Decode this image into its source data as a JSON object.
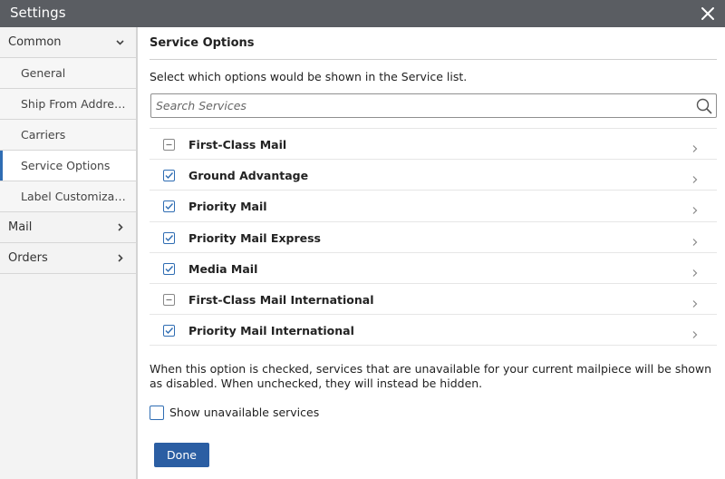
{
  "window": {
    "title": "Settings"
  },
  "sidebar": {
    "items": [
      {
        "label": "Common",
        "type": "section",
        "chevron": "chevron-down-icon"
      },
      {
        "label": "General",
        "type": "sub"
      },
      {
        "label": "Ship From Address...",
        "type": "sub"
      },
      {
        "label": "Carriers",
        "type": "sub"
      },
      {
        "label": "Service Options",
        "type": "sub",
        "active": true
      },
      {
        "label": "Label Customization",
        "type": "sub"
      },
      {
        "label": "Mail",
        "type": "section",
        "chevron": "chevron-right-icon"
      },
      {
        "label": "Orders",
        "type": "section",
        "chevron": "chevron-right-icon"
      }
    ]
  },
  "main": {
    "title": "Service Options",
    "intro": "Select which options would be shown in the Service list.",
    "search": {
      "placeholder": "Search Services",
      "value": ""
    },
    "services": [
      {
        "name": "First-Class Mail",
        "state": "indeterminate"
      },
      {
        "name": "Ground Advantage",
        "state": "checked"
      },
      {
        "name": "Priority Mail",
        "state": "checked"
      },
      {
        "name": "Priority Mail Express",
        "state": "checked"
      },
      {
        "name": "Media Mail",
        "state": "checked"
      },
      {
        "name": "First-Class Mail International",
        "state": "indeterminate"
      },
      {
        "name": "Priority Mail International",
        "state": "checked"
      }
    ],
    "note": "When this option is checked, services that are unavailable for your current mailpiece will be shown as disabled. When unchecked, they will instead be hidden.",
    "show_unavailable": {
      "label": "Show unavailable services",
      "checked": false
    },
    "done_label": "Done"
  },
  "colors": {
    "titlebar": "#5a5d62",
    "accent": "#2f6db3",
    "button": "#2b5ea3",
    "sidebar_bg": "#f3f3f3"
  }
}
